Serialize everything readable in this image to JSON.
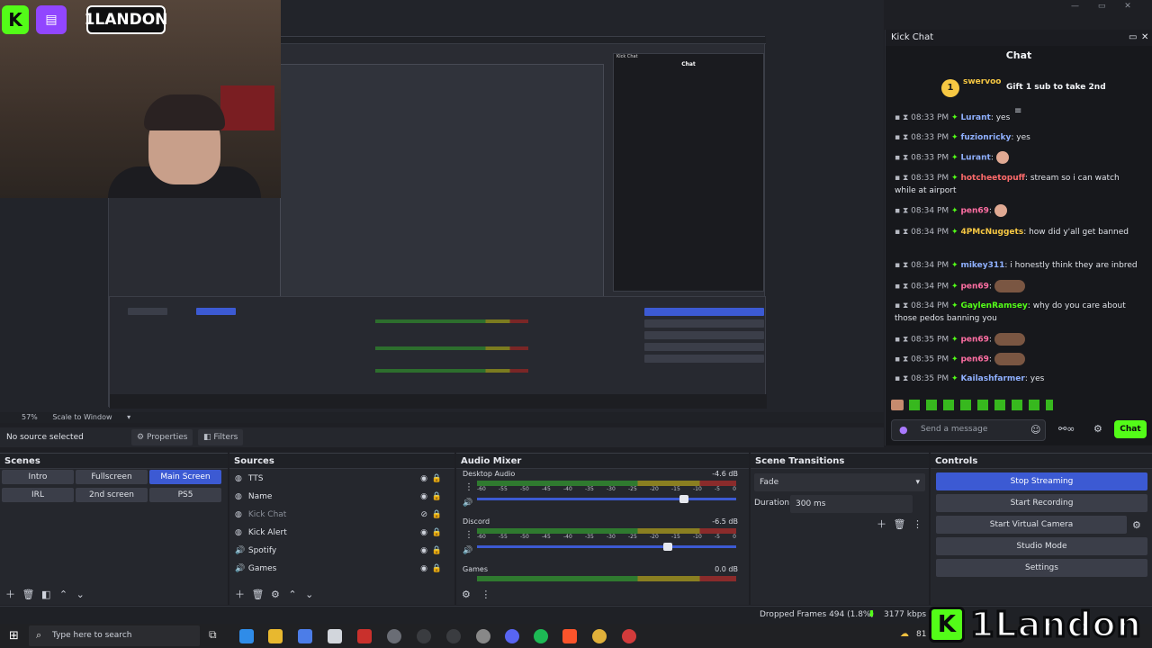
{
  "webcam": {
    "brand_text": "1LANDON"
  },
  "preview": {
    "inner_chat_title": "Kick Chat",
    "inner_chat_header": "Chat"
  },
  "zoom": {
    "value": "57%",
    "mode": "Scale to Window"
  },
  "no_source": "No source selected",
  "properties_label": "Properties",
  "filters_label": "Filters",
  "kick_chat": {
    "window_title": "Kick Chat",
    "header": "Chat",
    "pinned": {
      "user": "swervoo",
      "badge_count": "1",
      "text": "Gift 1 sub to take 2nd"
    },
    "messages": [
      {
        "time": "08:33 PM",
        "user": "Lurant",
        "text": "yes",
        "color": "u-blue"
      },
      {
        "time": "08:33 PM",
        "user": "fuzionricky",
        "text": "yes",
        "color": "u-blue"
      },
      {
        "time": "08:33 PM",
        "user": "Lurant",
        "text": "",
        "color": "u-blue"
      },
      {
        "time": "08:33 PM",
        "user": "hotcheetopuff",
        "text": "stream so i can watch while at airport",
        "color": "u-red"
      },
      {
        "time": "08:34 PM",
        "user": "pen69",
        "text": "",
        "color": "u-pink"
      },
      {
        "time": "08:34 PM",
        "user": "4PMcNuggets",
        "text": "how did y'all get banned",
        "color": "u-gold"
      },
      {
        "time": "08:34 PM",
        "user": "mikey311",
        "text": "i honestly think they are inbred",
        "color": "u-blue"
      },
      {
        "time": "08:34 PM",
        "user": "pen69",
        "text": "",
        "color": "u-pink"
      },
      {
        "time": "08:34 PM",
        "user": "GaylenRamsey",
        "text": "why do you care about those pedos banning you",
        "color": "u-green"
      },
      {
        "time": "08:35 PM",
        "user": "pen69",
        "text": "",
        "color": "u-pink"
      },
      {
        "time": "08:35 PM",
        "user": "pen69",
        "text": "",
        "color": "u-pink"
      },
      {
        "time": "08:35 PM",
        "user": "Kailashfarmer",
        "text": "yes",
        "color": "u-blue"
      }
    ],
    "input_placeholder": "Send a message",
    "send_label": "Chat"
  },
  "scenes": {
    "title": "Scenes",
    "items": [
      "Intro",
      "Fullscreen",
      "Main Screen",
      "IRL",
      "2nd screen",
      "PS5"
    ],
    "selected": "Main Screen"
  },
  "sources": {
    "title": "Sources",
    "items": [
      {
        "name": "TTS",
        "icon": "browser-icon"
      },
      {
        "name": "Name",
        "icon": "browser-icon"
      },
      {
        "name": "Kick Chat",
        "icon": "browser-icon"
      },
      {
        "name": "Kick Alert",
        "icon": "browser-icon"
      },
      {
        "name": "Spotify",
        "icon": "audio-icon"
      },
      {
        "name": "Games",
        "icon": "audio-icon"
      }
    ]
  },
  "mixer": {
    "title": "Audio Mixer",
    "channels": [
      {
        "name": "Desktop Audio",
        "db": "-4.6 dB",
        "volume": 0.78
      },
      {
        "name": "Discord",
        "db": "-6.5 dB",
        "volume": 0.72
      },
      {
        "name": "Games",
        "db": "0.0 dB",
        "volume": 1.0
      }
    ],
    "ticks": [
      "-60",
      "-55",
      "-50",
      "-45",
      "-40",
      "-35",
      "-30",
      "-25",
      "-20",
      "-15",
      "-10",
      "-5",
      "0"
    ]
  },
  "transitions": {
    "title": "Scene Transitions",
    "selected": "Fade",
    "duration_label": "Duration",
    "duration_value": "300 ms"
  },
  "controls": {
    "title": "Controls",
    "buttons": [
      "Stop Streaming",
      "Start Recording",
      "Start Virtual Camera",
      "Studio Mode",
      "Settings"
    ]
  },
  "status": {
    "dropped": "Dropped Frames 494 (1.8%)",
    "kbps": "3177 kbps"
  },
  "taskbar": {
    "search_placeholder": "Type here to search",
    "temp": "81"
  },
  "brand": {
    "overlay_text": "1Landon"
  }
}
